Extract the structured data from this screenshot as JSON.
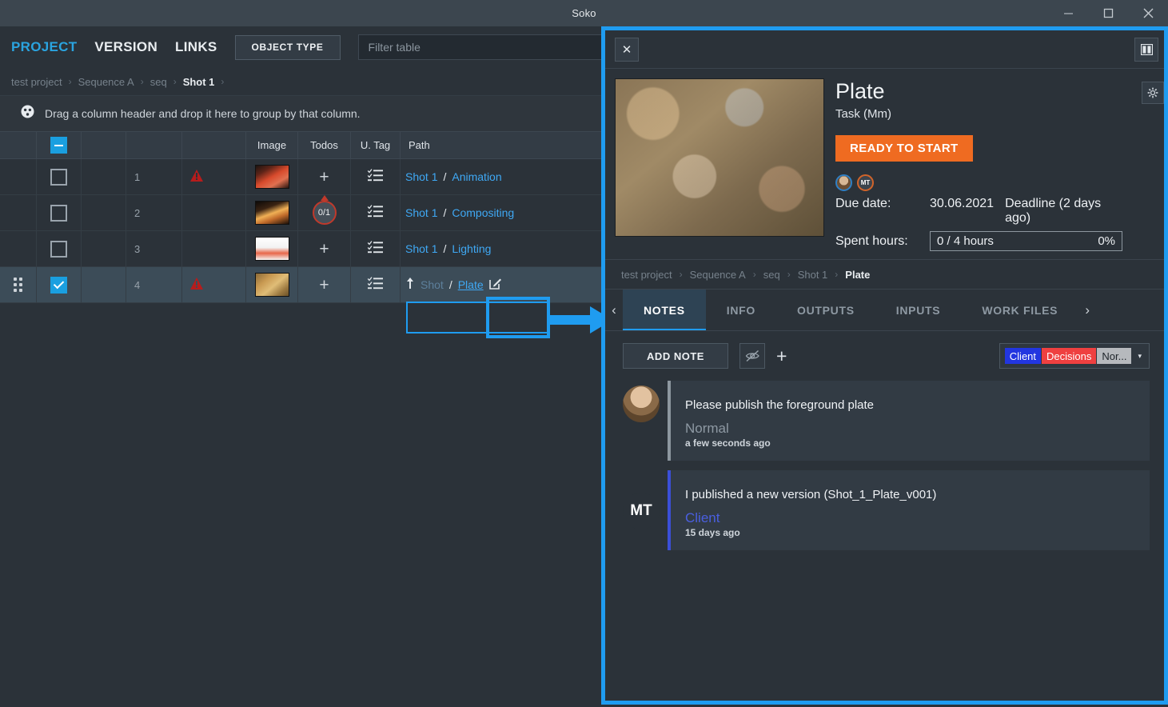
{
  "window": {
    "title": "Soko",
    "minimize_label": "minimize",
    "maximize_label": "maximize",
    "close_label": "close"
  },
  "topbar": {
    "nav": [
      {
        "label": "PROJECT",
        "active": true
      },
      {
        "label": "VERSION",
        "active": false
      },
      {
        "label": "LINKS",
        "active": false
      }
    ],
    "object_type_label": "OBJECT TYPE",
    "filter_placeholder": "Filter table",
    "filter_value": ""
  },
  "breadcrumb": {
    "items": [
      "test project",
      "Sequence A",
      "seq",
      "Shot 1"
    ],
    "separator": "›",
    "current_index": 3,
    "trailing_separator": "›"
  },
  "group_bar": {
    "icon": "group-by-icon",
    "text": "Drag a column header and drop it here to group by that column."
  },
  "table": {
    "headers": [
      "",
      "",
      "",
      "",
      "",
      "Image",
      "Todos",
      "U. Tag",
      "Path"
    ],
    "header_labels": {
      "image": "Image",
      "todos": "Todos",
      "utag": "U. Tag",
      "path": "Path"
    },
    "rows": [
      {
        "num": "1",
        "checked": false,
        "selected": false,
        "warning": true,
        "todo": "+",
        "todo_kind": "plus",
        "path_prefix": "Shot 1",
        "path_sep": "/",
        "path_leaf": "Animation"
      },
      {
        "num": "2",
        "checked": false,
        "selected": false,
        "warning": false,
        "todo": "0/1",
        "todo_kind": "badge",
        "path_prefix": "Shot 1",
        "path_sep": "/",
        "path_leaf": "Compositing"
      },
      {
        "num": "3",
        "checked": false,
        "selected": false,
        "warning": false,
        "todo": "+",
        "todo_kind": "plus",
        "path_prefix": "Shot 1",
        "path_sep": "/",
        "path_leaf": "Lighting"
      },
      {
        "num": "4",
        "checked": true,
        "selected": true,
        "warning": true,
        "todo": "+",
        "todo_kind": "plus",
        "path_prefix": "Shot",
        "path_sep": "/",
        "path_leaf": "Plate"
      }
    ]
  },
  "detail": {
    "close_label": "✕",
    "layout_toggle_name": "split-view-icon",
    "title": "Plate",
    "subtitle": "Task (Mm)",
    "status": "READY TO START",
    "status_color": "#ef6b21",
    "avatars": [
      {
        "name": "user-photo-avatar",
        "initials": ""
      },
      {
        "name": "user-mt-avatar",
        "initials": "MT"
      }
    ],
    "due_date_label": "Due date:",
    "due_date_value": "30.06.2021",
    "deadline_note": "Deadline (2 days ago)",
    "spent_hours_label": "Spent hours:",
    "spent_hours_value": "0 / 4 hours",
    "spent_hours_pct": "0%",
    "settings_icon": "gear-icon",
    "breadcrumb": {
      "items": [
        "test project",
        "Sequence A",
        "seq",
        "Shot 1",
        "Plate"
      ],
      "separator": "›",
      "current_index": 4
    },
    "tabs": {
      "prev_arrow": "‹",
      "next_arrow": "›",
      "items": [
        {
          "label": "NOTES",
          "active": true
        },
        {
          "label": "INFO",
          "active": false
        },
        {
          "label": "OUTPUTS",
          "active": false
        },
        {
          "label": "INPUTS",
          "active": false
        },
        {
          "label": "WORK FILES",
          "active": false
        }
      ]
    },
    "notes_toolbar": {
      "add_note_label": "ADD NOTE",
      "eye_off_icon": "eye-off-icon",
      "add_icon": "plus-icon",
      "tag_chips": [
        {
          "label": "Client",
          "color": "#2236e0"
        },
        {
          "label": "Decisions",
          "color": "#ef4040"
        },
        {
          "label": "Nor...",
          "color": "#b6b9bd"
        }
      ],
      "caret": "▾"
    },
    "notes": [
      {
        "author_avatar": "photo",
        "initials": "",
        "text": "Please publish the foreground plate",
        "category": "Normal",
        "category_kind": "normal",
        "time": "a few seconds ago"
      },
      {
        "author_avatar": "initials",
        "initials": "MT",
        "text": "I published a new version (Shot_1_Plate_v001)",
        "category": "Client",
        "category_kind": "client",
        "time": "15 days ago"
      }
    ]
  },
  "colors": {
    "accent_blue": "#1f9cf0",
    "link_blue": "#3fa9f5",
    "status_orange": "#ef6b21",
    "warning_red": "#c62828",
    "panel_bg": "#2b3239",
    "header_bg": "#333c45"
  }
}
